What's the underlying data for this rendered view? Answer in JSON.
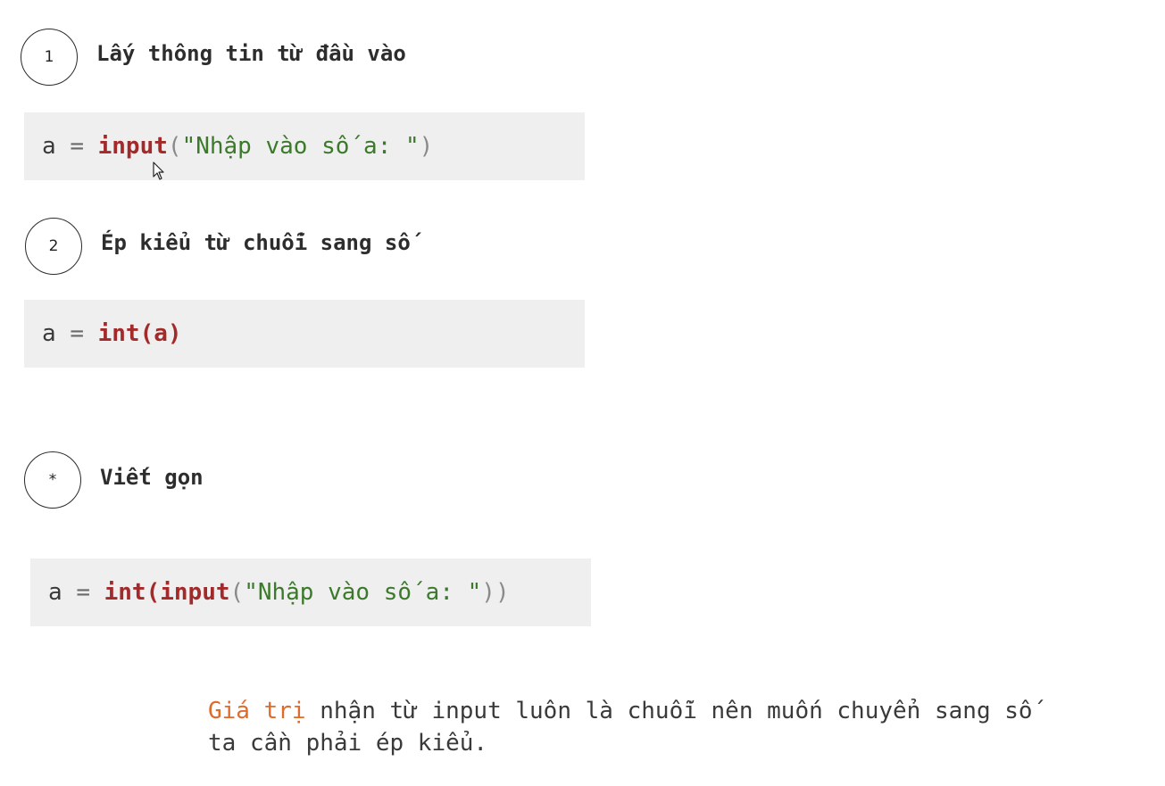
{
  "steps": [
    {
      "badge": "1",
      "title": "Lấy thông tin từ đầu vào",
      "code": {
        "var": "a",
        "op": "=",
        "fn": "input",
        "open": "(",
        "str": "\"Nhập vào số a: \"",
        "close": ")"
      }
    },
    {
      "badge": "2",
      "title": "Ép kiểu từ chuỗi sang số",
      "code": {
        "var": "a",
        "op": "=",
        "expr": "int(a)"
      }
    },
    {
      "badge": "*",
      "title": "Viết gọn",
      "code": {
        "var": "a",
        "op": "=",
        "fn_outer": "int(",
        "fn_inner": "input",
        "open": "(",
        "str": "\"Nhập vào số a: \"",
        "close": ")",
        "close_outer": ")"
      }
    }
  ],
  "note": {
    "highlight": "Giá trị",
    "line1_rest": " nhận từ input luôn là chuỗi nên muốn chuyển sang số",
    "line2": "ta cần phải ép kiểu."
  },
  "colors": {
    "keyword": "#a32a2a",
    "string": "#3b7a2a",
    "highlight": "#e06a2a",
    "code_bg": "#efefef"
  },
  "icons": {
    "cursor": "mouse-pointer-icon"
  }
}
